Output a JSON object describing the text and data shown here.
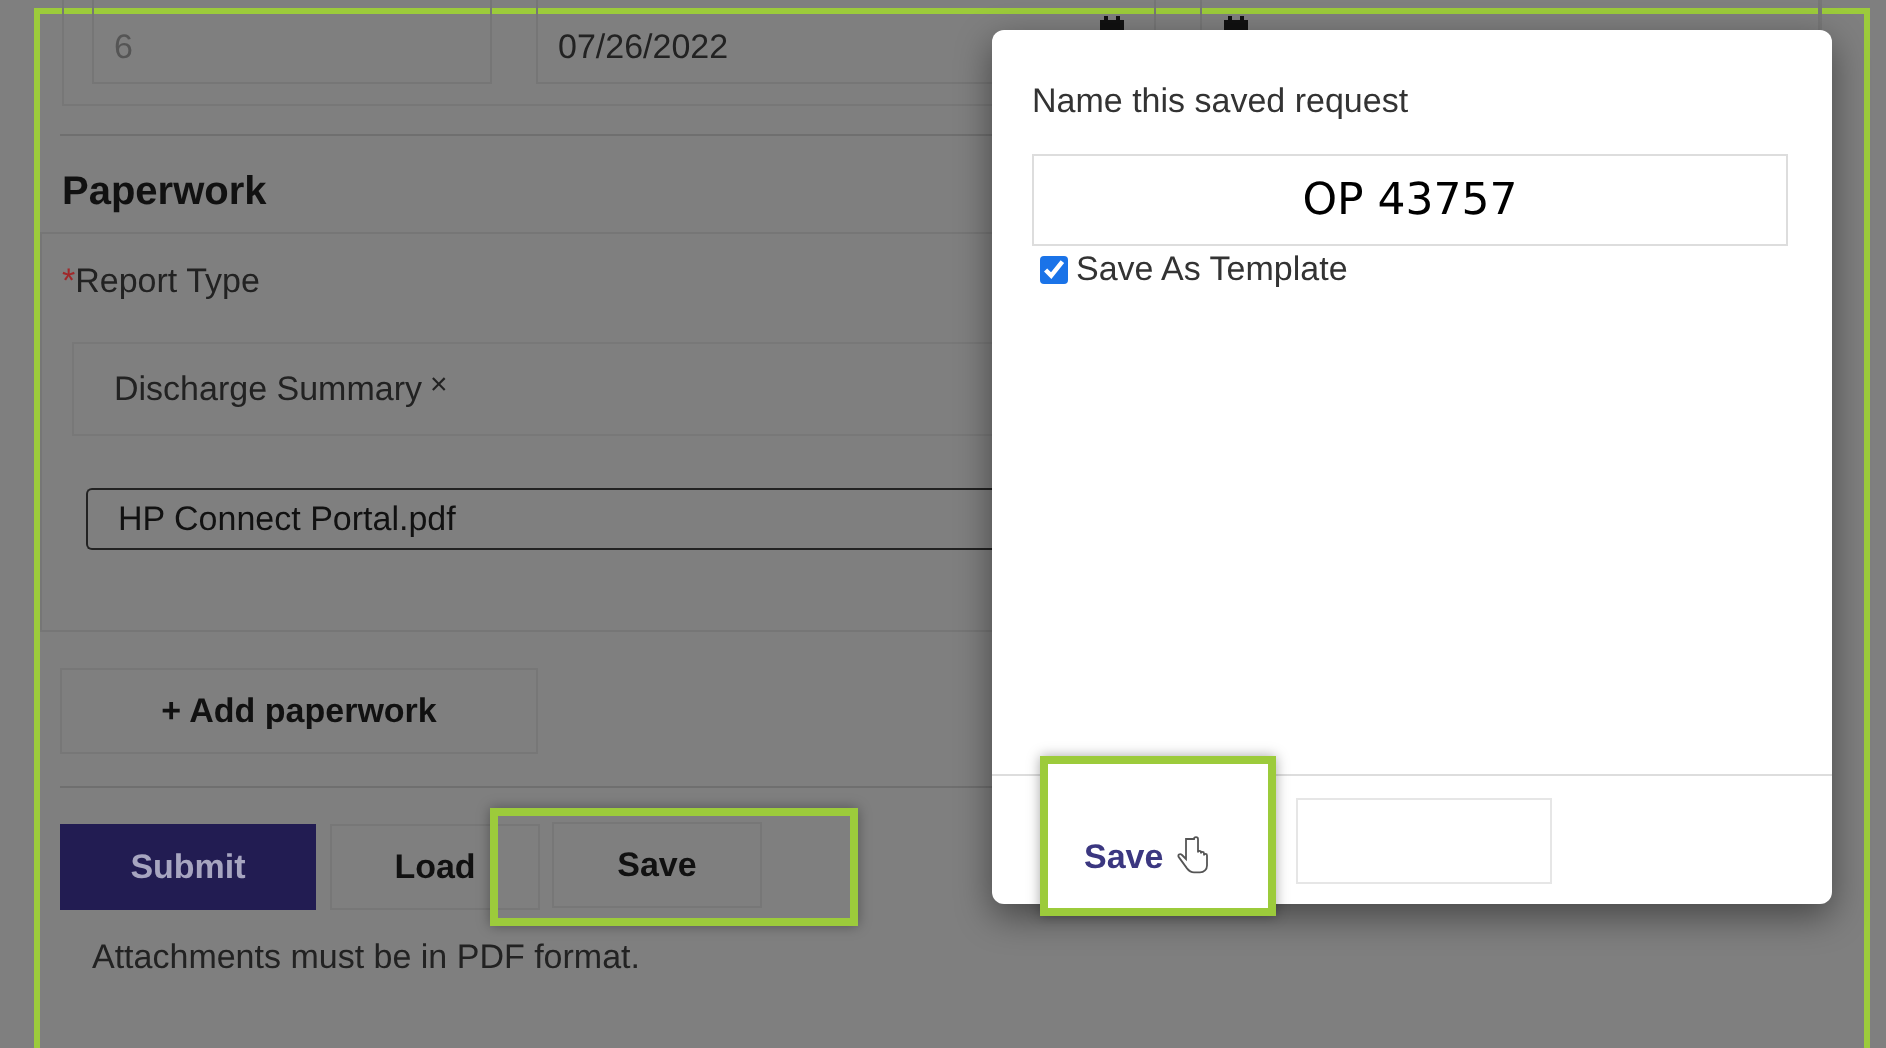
{
  "form": {
    "top_fields": [
      {
        "kind": "text",
        "value": "6"
      },
      {
        "kind": "date",
        "value": "07/26/2022"
      },
      {
        "kind": "date"
      }
    ]
  },
  "paperwork": {
    "title": "Paperwork",
    "report_type": {
      "label": "Report Type",
      "required_mark": "*",
      "tags": [
        {
          "label": "Discharge Summary",
          "remove": "×"
        }
      ]
    },
    "files": [
      "HP Connect Portal.pdf"
    ],
    "add_button": "+ Add paperwork"
  },
  "actions": [
    {
      "label": "Submit",
      "kind": "primary",
      "highlighted": false
    },
    {
      "label": "Load",
      "kind": "default",
      "highlighted": false
    },
    {
      "label": "Save",
      "kind": "default",
      "highlighted": true
    }
  ],
  "note": "Attachments must be in PDF format.",
  "modal": {
    "label": "Name this saved request",
    "name_value": "OP 43757",
    "template": {
      "label": "Save As Template",
      "checked": true
    },
    "footer_buttons": [
      {
        "kind": "link",
        "label": "Save",
        "highlighted": true
      },
      {
        "kind": "empty"
      }
    ]
  }
}
